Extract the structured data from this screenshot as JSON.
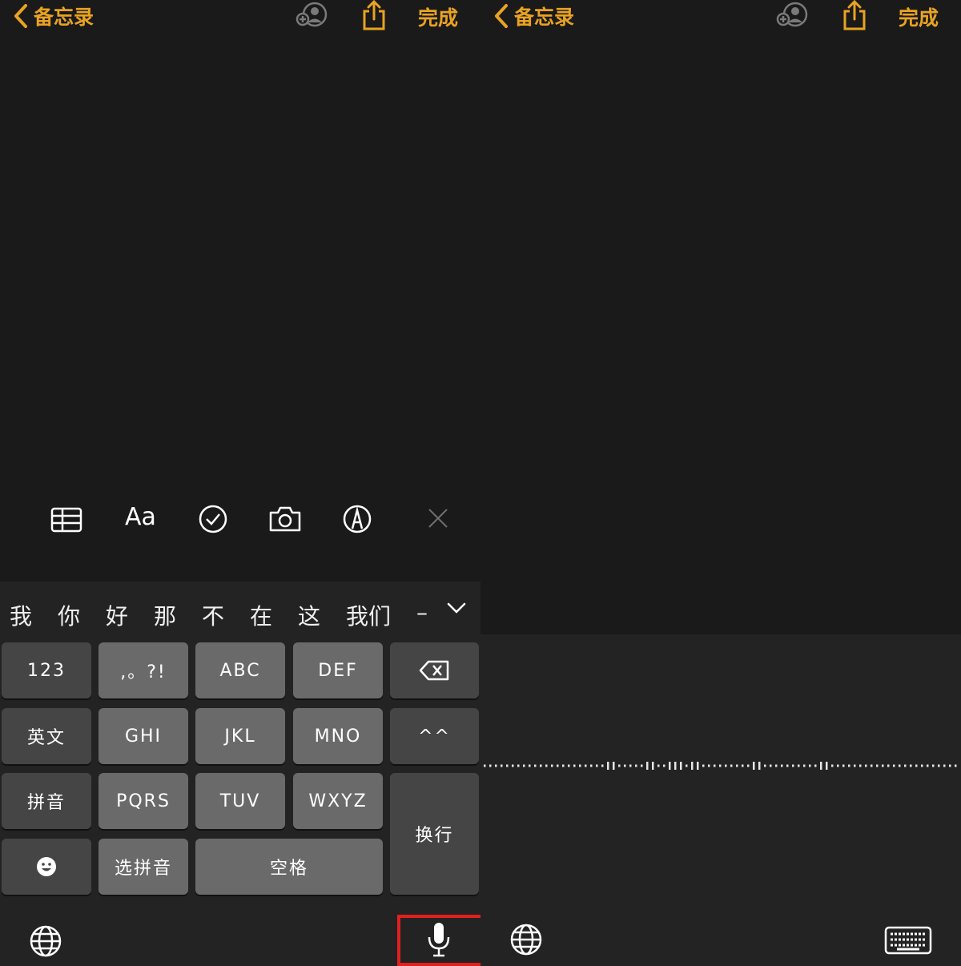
{
  "screens": [
    {
      "nav": {
        "back_label": "备忘录",
        "done_label": "完成"
      },
      "toolbar": {
        "format_label": "Aa"
      },
      "candidates": [
        "我",
        "你",
        "好",
        "那",
        "不",
        "在",
        "这",
        "我们",
        "–"
      ],
      "keyboard": {
        "keys": {
          "num": "123",
          "punct": ",。?!",
          "abc": "ABC",
          "def": "DEF",
          "english": "英文",
          "ghi": "GHI",
          "jkl": "JKL",
          "mno": "MNO",
          "caret": "^^",
          "pinyin": "拼音",
          "pqrs": "PQRS",
          "tuv": "TUV",
          "wxyz": "WXYZ",
          "newline": "换行",
          "choose_pinyin": "选拼音",
          "space": "空格"
        }
      }
    },
    {
      "nav": {
        "back_label": "备忘录",
        "done_label": "完成"
      }
    }
  ],
  "icons": {
    "back": "chevron-left-icon",
    "collab": "people-icon",
    "share": "share-icon",
    "table": "table-icon",
    "checklist": "checkmark-circle-icon",
    "camera": "camera-icon",
    "markup": "pen-circle-icon",
    "close": "close-icon",
    "expand": "chevron-down-icon",
    "delete": "delete-backspace-icon",
    "emoji": "emoji-icon",
    "globe": "globe-icon",
    "mic": "microphone-icon",
    "keyboard": "keyboard-icon"
  },
  "colors": {
    "accent": "#e9a321",
    "background": "#1a1a1a",
    "key": "#6a6a6a",
    "key_dark": "#454545",
    "highlight": "#e0201f"
  }
}
